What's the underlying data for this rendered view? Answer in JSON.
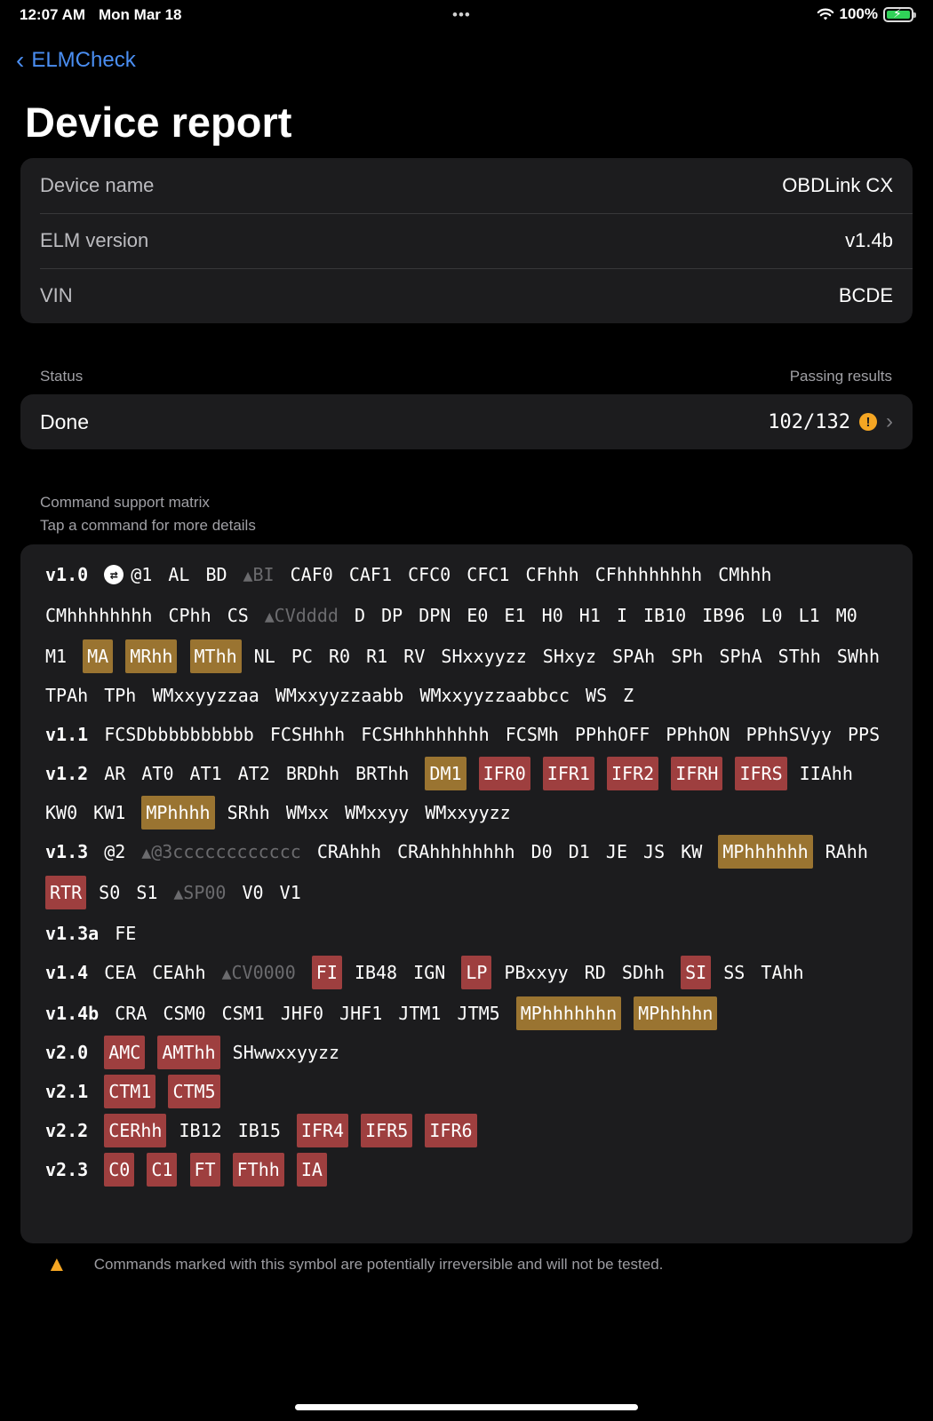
{
  "status_bar": {
    "time": "12:07 AM",
    "date": "Mon Mar 18",
    "dots": "•••",
    "battery_pct": "100%"
  },
  "nav": {
    "back_label": "ELMCheck"
  },
  "title": "Device report",
  "device_info": [
    {
      "label": "Device name",
      "value": "OBDLink CX"
    },
    {
      "label": "ELM version",
      "value": "v1.4b"
    },
    {
      "label": "VIN",
      "value": "BCDE"
    }
  ],
  "status_section": {
    "label": "Status",
    "right_label": "Passing results",
    "status": "Done",
    "passing": "102/132"
  },
  "matrix_section": {
    "label": "Command support matrix",
    "hint": "Tap a command for more details"
  },
  "colors": {
    "partial": "#9a7431",
    "failed": "#9e3f3f",
    "accent": "#4a8ef2",
    "warning": "#f5a623"
  },
  "matrix": [
    {
      "version": "v1.0",
      "cycle": true,
      "commands": [
        [
          "@1",
          ""
        ],
        [
          "AL",
          ""
        ],
        [
          "BD",
          ""
        ],
        [
          "BI",
          "warn"
        ],
        [
          "CAF0",
          ""
        ],
        [
          "CAF1",
          ""
        ],
        [
          "CFC0",
          ""
        ],
        [
          "CFC1",
          ""
        ],
        [
          "CFhhh",
          ""
        ],
        [
          "CFhhhhhhhh",
          ""
        ],
        [
          "CMhhh",
          ""
        ],
        [
          "CMhhhhhhhh",
          ""
        ],
        [
          "CPhh",
          ""
        ],
        [
          "CS",
          ""
        ],
        [
          "CVdddd",
          "warn"
        ],
        [
          "D",
          ""
        ],
        [
          "DP",
          ""
        ],
        [
          "DPN",
          ""
        ],
        [
          "E0",
          ""
        ],
        [
          "E1",
          ""
        ],
        [
          "H0",
          ""
        ],
        [
          "H1",
          ""
        ],
        [
          "I",
          ""
        ],
        [
          "IB10",
          ""
        ],
        [
          "IB96",
          ""
        ],
        [
          "L0",
          ""
        ],
        [
          "L1",
          ""
        ],
        [
          "M0",
          ""
        ],
        [
          "M1",
          ""
        ],
        [
          "MA",
          "orange"
        ],
        [
          "MRhh",
          "orange"
        ],
        [
          "MThh",
          "orange"
        ],
        [
          "NL",
          ""
        ],
        [
          "PC",
          ""
        ],
        [
          "R0",
          ""
        ],
        [
          "R1",
          ""
        ],
        [
          "RV",
          ""
        ],
        [
          "SHxxyyzz",
          ""
        ],
        [
          "SHxyz",
          ""
        ],
        [
          "SPAh",
          ""
        ],
        [
          "SPh",
          ""
        ],
        [
          "SPhA",
          ""
        ],
        [
          "SThh",
          ""
        ],
        [
          "SWhh",
          ""
        ],
        [
          "TPAh",
          ""
        ],
        [
          "TPh",
          ""
        ],
        [
          "WMxxyyzzaa",
          ""
        ],
        [
          "WMxxyyzzaabb",
          ""
        ],
        [
          "WMxxyyzzaabbcc",
          ""
        ],
        [
          "WS",
          ""
        ],
        [
          "Z",
          ""
        ]
      ]
    },
    {
      "version": "v1.1",
      "commands": [
        [
          "FCSDbbbbbbbbbb",
          ""
        ],
        [
          "FCSHhhh",
          ""
        ],
        [
          "FCSHhhhhhhhh",
          ""
        ],
        [
          "FCSMh",
          ""
        ],
        [
          "PPhhOFF",
          ""
        ],
        [
          "PPhhON",
          ""
        ],
        [
          "PPhhSVyy",
          ""
        ],
        [
          "PPS",
          ""
        ]
      ]
    },
    {
      "version": "v1.2",
      "commands": [
        [
          "AR",
          ""
        ],
        [
          "AT0",
          ""
        ],
        [
          "AT1",
          ""
        ],
        [
          "AT2",
          ""
        ],
        [
          "BRDhh",
          ""
        ],
        [
          "BRThh",
          ""
        ],
        [
          "DM1",
          "orange"
        ],
        [
          "IFR0",
          "red"
        ],
        [
          "IFR1",
          "red"
        ],
        [
          "IFR2",
          "red"
        ],
        [
          "IFRH",
          "red"
        ],
        [
          "IFRS",
          "red"
        ],
        [
          "IIAhh",
          ""
        ],
        [
          "KW0",
          ""
        ],
        [
          "KW1",
          ""
        ],
        [
          "MPhhhh",
          "orange"
        ],
        [
          "SRhh",
          ""
        ],
        [
          "WMxx",
          ""
        ],
        [
          "WMxxyy",
          ""
        ],
        [
          "WMxxyyzz",
          ""
        ]
      ]
    },
    {
      "version": "v1.3",
      "commands": [
        [
          "@2",
          ""
        ],
        [
          "@3cccccccccccc",
          "warn"
        ],
        [
          "CRAhhh",
          ""
        ],
        [
          "CRAhhhhhhhh",
          ""
        ],
        [
          "D0",
          ""
        ],
        [
          "D1",
          ""
        ],
        [
          "JE",
          ""
        ],
        [
          "JS",
          ""
        ],
        [
          "KW",
          ""
        ],
        [
          "MPhhhhhh",
          "orange"
        ],
        [
          "RAhh",
          ""
        ],
        [
          "RTR",
          "red"
        ],
        [
          "S0",
          ""
        ],
        [
          "S1",
          ""
        ],
        [
          "SP00",
          "warn"
        ],
        [
          "V0",
          ""
        ],
        [
          "V1",
          ""
        ]
      ]
    },
    {
      "version": "v1.3a",
      "commands": [
        [
          "FE",
          ""
        ]
      ]
    },
    {
      "version": "v1.4",
      "commands": [
        [
          "CEA",
          ""
        ],
        [
          "CEAhh",
          ""
        ],
        [
          "CV0000",
          "warn"
        ],
        [
          "FI",
          "red"
        ],
        [
          "IB48",
          ""
        ],
        [
          "IGN",
          ""
        ],
        [
          "LP",
          "red"
        ],
        [
          "PBxxyy",
          ""
        ],
        [
          "RD",
          ""
        ],
        [
          "SDhh",
          ""
        ],
        [
          "SI",
          "red"
        ],
        [
          "SS",
          ""
        ],
        [
          "TAhh",
          ""
        ]
      ]
    },
    {
      "version": "v1.4b",
      "commands": [
        [
          "CRA",
          ""
        ],
        [
          "CSM0",
          ""
        ],
        [
          "CSM1",
          ""
        ],
        [
          "JHF0",
          ""
        ],
        [
          "JHF1",
          ""
        ],
        [
          "JTM1",
          ""
        ],
        [
          "JTM5",
          ""
        ],
        [
          "MPhhhhhhn",
          "orange"
        ],
        [
          "MPhhhhn",
          "orange"
        ]
      ]
    },
    {
      "version": "v2.0",
      "commands": [
        [
          "AMC",
          "red"
        ],
        [
          "AMThh",
          "red"
        ],
        [
          "SHwwxxyyzz",
          ""
        ]
      ]
    },
    {
      "version": "v2.1",
      "commands": [
        [
          "CTM1",
          "red"
        ],
        [
          "CTM5",
          "red"
        ]
      ]
    },
    {
      "version": "v2.2",
      "commands": [
        [
          "CERhh",
          "red"
        ],
        [
          "IB12",
          ""
        ],
        [
          "IB15",
          ""
        ],
        [
          "IFR4",
          "red"
        ],
        [
          "IFR5",
          "red"
        ],
        [
          "IFR6",
          "red"
        ]
      ]
    },
    {
      "version": "v2.3",
      "commands": [
        [
          "C0",
          "red"
        ],
        [
          "C1",
          "red"
        ],
        [
          "FT",
          "red"
        ],
        [
          "FThh",
          "red"
        ],
        [
          "IA",
          "red"
        ]
      ]
    }
  ],
  "footnote": "Commands marked with this symbol are potentially irreversible and will not be tested.",
  "icons": {
    "back": "chevron-left-icon",
    "cycle": "cycle-icon",
    "warn": "warning-triangle-icon",
    "status_warn": "exclamation-circle-icon",
    "disclosure": "chevron-right-icon",
    "wifi": "wifi-icon",
    "battery": "battery-charging-icon"
  }
}
